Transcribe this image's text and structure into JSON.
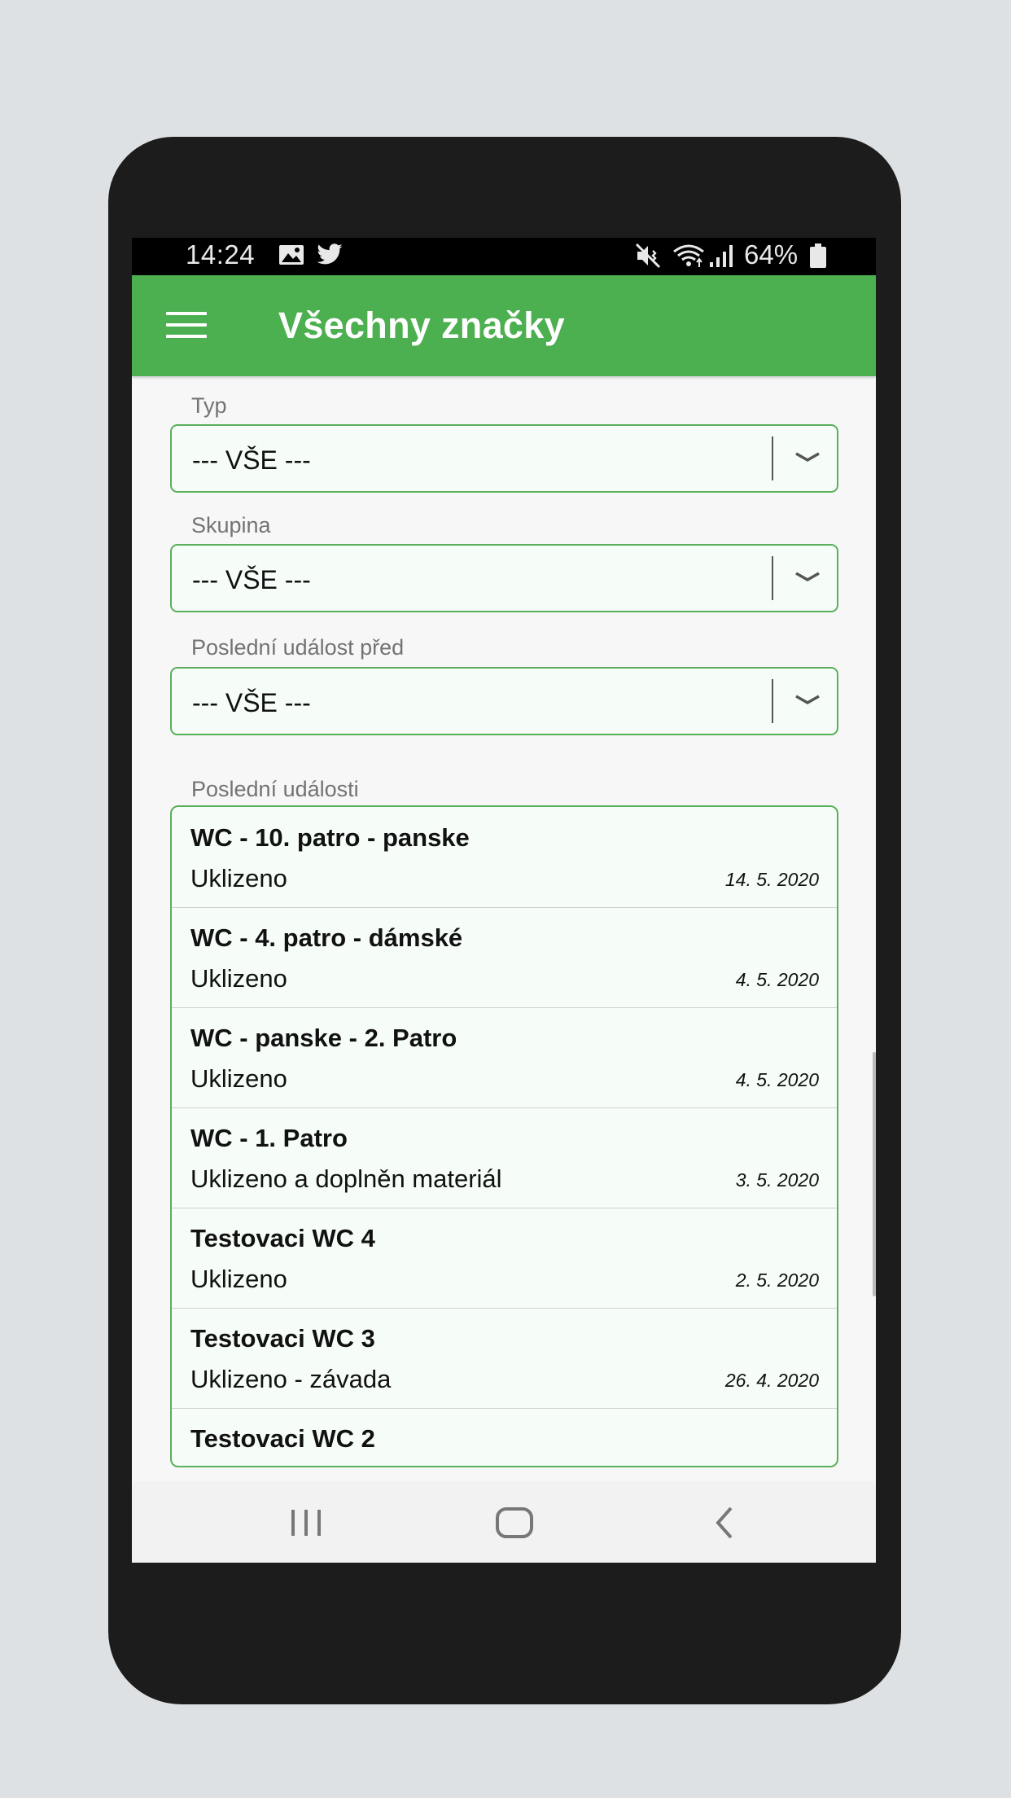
{
  "status_bar": {
    "time": "14:24",
    "battery": "64%",
    "icons": [
      "image-icon",
      "twitter-icon",
      "mute-icon",
      "wifi-icon",
      "signal-icon",
      "battery-icon"
    ]
  },
  "app_bar": {
    "title": "Všechny značky",
    "accent_color": "#4caf50"
  },
  "filters": {
    "type": {
      "label": "Typ",
      "value": "--- VŠE ---"
    },
    "group": {
      "label": "Skupina",
      "value": "--- VŠE ---"
    },
    "last_event_before": {
      "label": "Poslední událost před",
      "value": "--- VŠE ---"
    }
  },
  "events": {
    "label": "Poslední události",
    "items": [
      {
        "name": "WC - 10. patro - panske",
        "status": "Uklizeno",
        "date": "14. 5. 2020"
      },
      {
        "name": "WC - 4. patro - dámské",
        "status": "Uklizeno",
        "date": "4. 5. 2020"
      },
      {
        "name": "WC - panske - 2. Patro",
        "status": "Uklizeno",
        "date": "4. 5. 2020"
      },
      {
        "name": "WC - 1. Patro",
        "status": "Uklizeno a doplněn materiál",
        "date": "3. 5. 2020"
      },
      {
        "name": "Testovaci WC 4",
        "status": "Uklizeno",
        "date": "2. 5. 2020"
      },
      {
        "name": "Testovaci WC 3",
        "status": "Uklizeno - závada",
        "date": "26. 4. 2020"
      },
      {
        "name": "Testovaci WC 2",
        "status": "",
        "date": ""
      }
    ]
  },
  "nav_bar": {
    "buttons": [
      "recents-icon",
      "home-icon",
      "back-icon"
    ]
  }
}
